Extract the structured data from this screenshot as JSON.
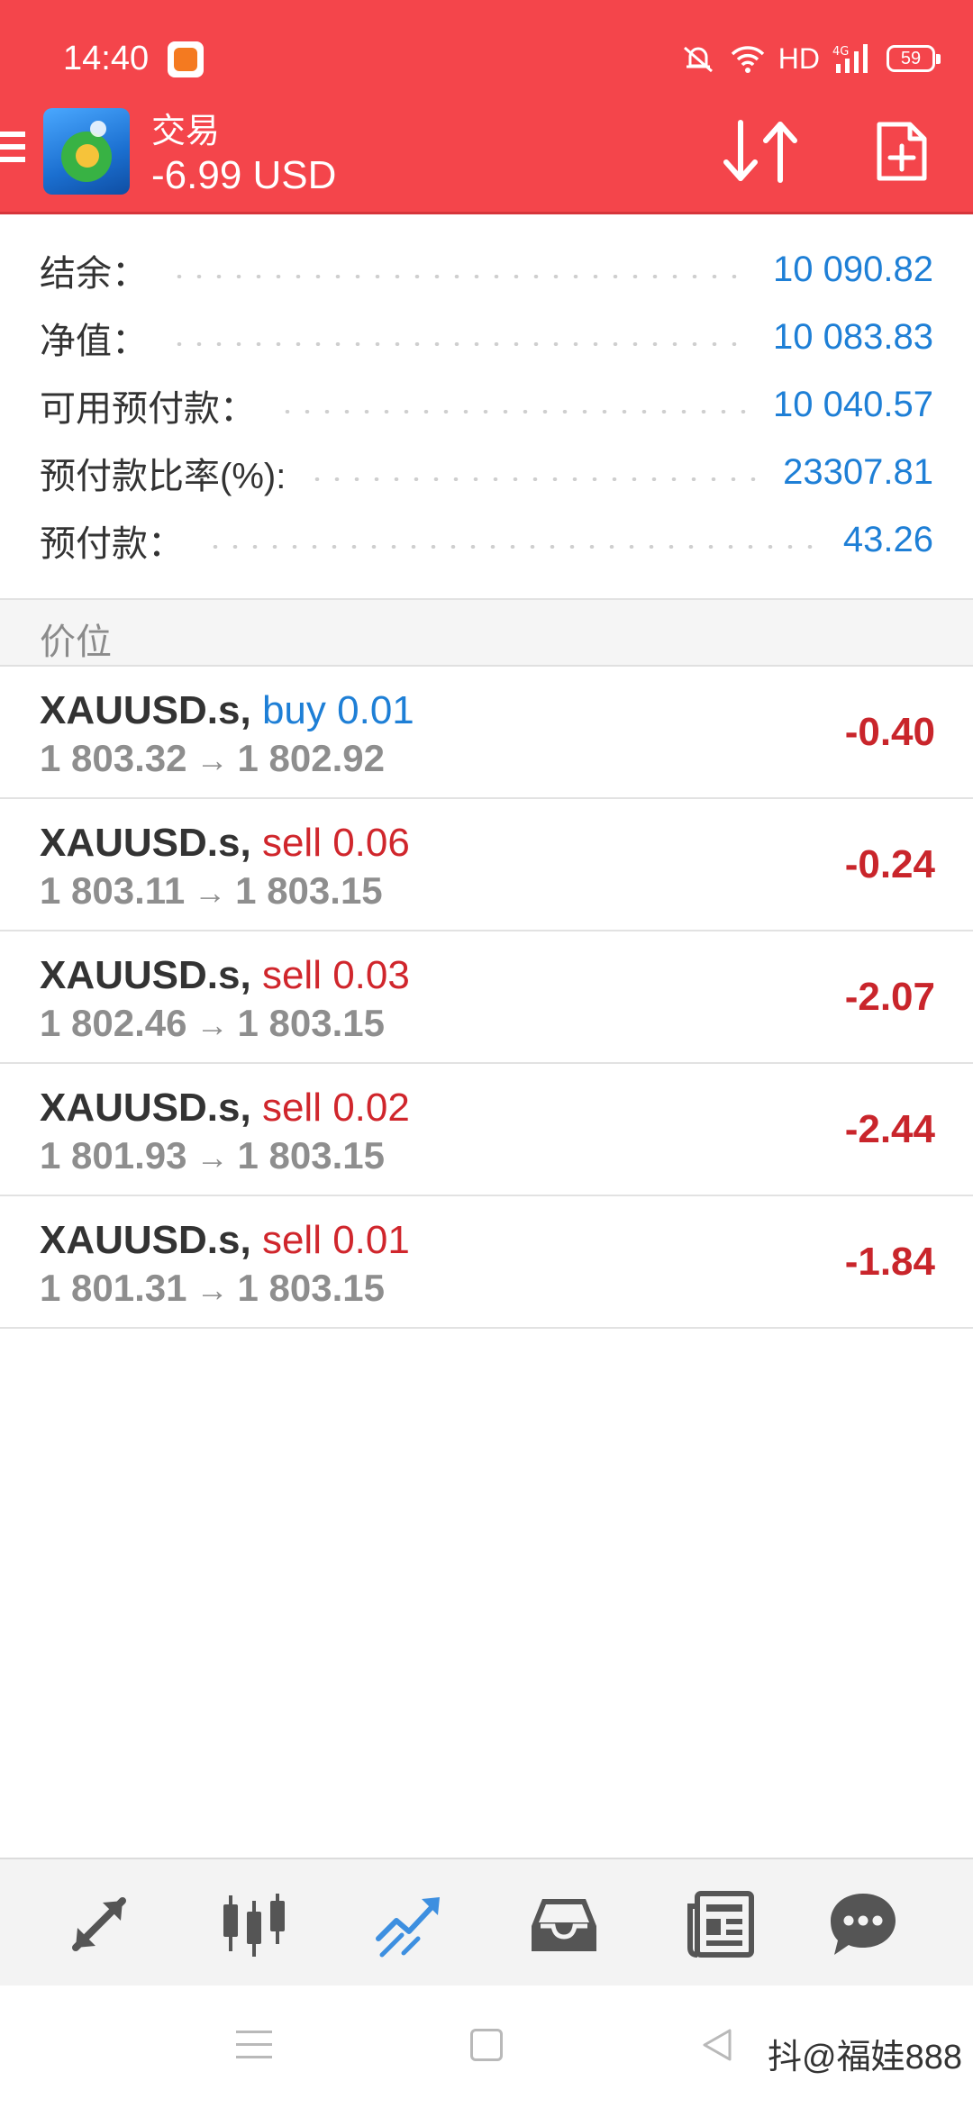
{
  "status_bar": {
    "time": "14:40",
    "network": "HD",
    "battery": "59"
  },
  "header": {
    "title": "交易",
    "profit": "-6.99 USD"
  },
  "summary": [
    {
      "label": "结余：",
      "value": "10 090.82"
    },
    {
      "label": "净值：",
      "value": "10 083.83"
    },
    {
      "label": "可用预付款：",
      "value": "10 040.57"
    },
    {
      "label": "预付款比率(%):",
      "value": "23307.81"
    },
    {
      "label": "预付款：",
      "value": "43.26"
    }
  ],
  "section": {
    "title": "价位"
  },
  "positions": [
    {
      "symbol": "XAUUSD.s,",
      "type": "buy 0.01",
      "open": "1 803.32",
      "arrow": "→",
      "current": "1 802.92",
      "profit": "-0.40"
    },
    {
      "symbol": "XAUUSD.s,",
      "type": "sell 0.06",
      "open": "1 803.11",
      "arrow": "→",
      "current": "1 803.15",
      "profit": "-0.24"
    },
    {
      "symbol": "XAUUSD.s,",
      "type": "sell 0.03",
      "open": "1 802.46",
      "arrow": "→",
      "current": "1 803.15",
      "profit": "-2.07"
    },
    {
      "symbol": "XAUUSD.s,",
      "type": "sell 0.02",
      "open": "1 801.93",
      "arrow": "→",
      "current": "1 803.15",
      "profit": "-2.44"
    },
    {
      "symbol": "XAUUSD.s,",
      "type": "sell 0.01",
      "open": "1 801.31",
      "arrow": "→",
      "current": "1 803.15",
      "profit": "-1.84"
    }
  ],
  "bottom_nav": [
    {
      "icon": "quotes-arrows-icon",
      "active": false
    },
    {
      "icon": "candlestick-chart-icon",
      "active": false
    },
    {
      "icon": "trade-trend-icon",
      "active": true
    },
    {
      "icon": "history-inbox-icon",
      "active": false
    },
    {
      "icon": "news-icon",
      "active": false
    },
    {
      "icon": "chat-icon",
      "active": false
    }
  ],
  "colors": {
    "header_red": "#f4454b",
    "value_blue": "#1e7fd6",
    "loss_red": "#c9252b",
    "active_nav_blue": "#3d8fe0",
    "nav_grey": "#555555"
  },
  "watermark": "抖@福娃888"
}
